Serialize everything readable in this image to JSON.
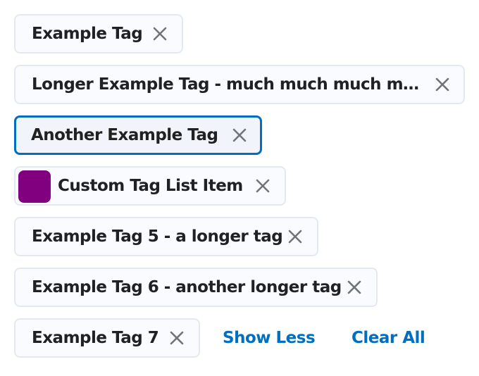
{
  "tags": [
    {
      "label": "Example Tag"
    },
    {
      "label": "Longer Example Tag - much much much much much much much much longer"
    },
    {
      "label": "Another Example Tag"
    },
    {
      "label": "Custom Tag List Item",
      "swatch_color": "#800080"
    },
    {
      "label": "Example Tag 5 - a longer tag"
    },
    {
      "label": "Example Tag 6 - another longer tag"
    },
    {
      "label": "Example Tag 7"
    }
  ],
  "actions": {
    "show_less_label": "Show Less",
    "clear_all_label": "Clear All"
  },
  "colors": {
    "tag_background": "#f9fbff",
    "tag_border": "#e3e9f1",
    "focus_ring": "#006fbf",
    "link": "#006fbf",
    "close_icon": "#6e7477"
  }
}
